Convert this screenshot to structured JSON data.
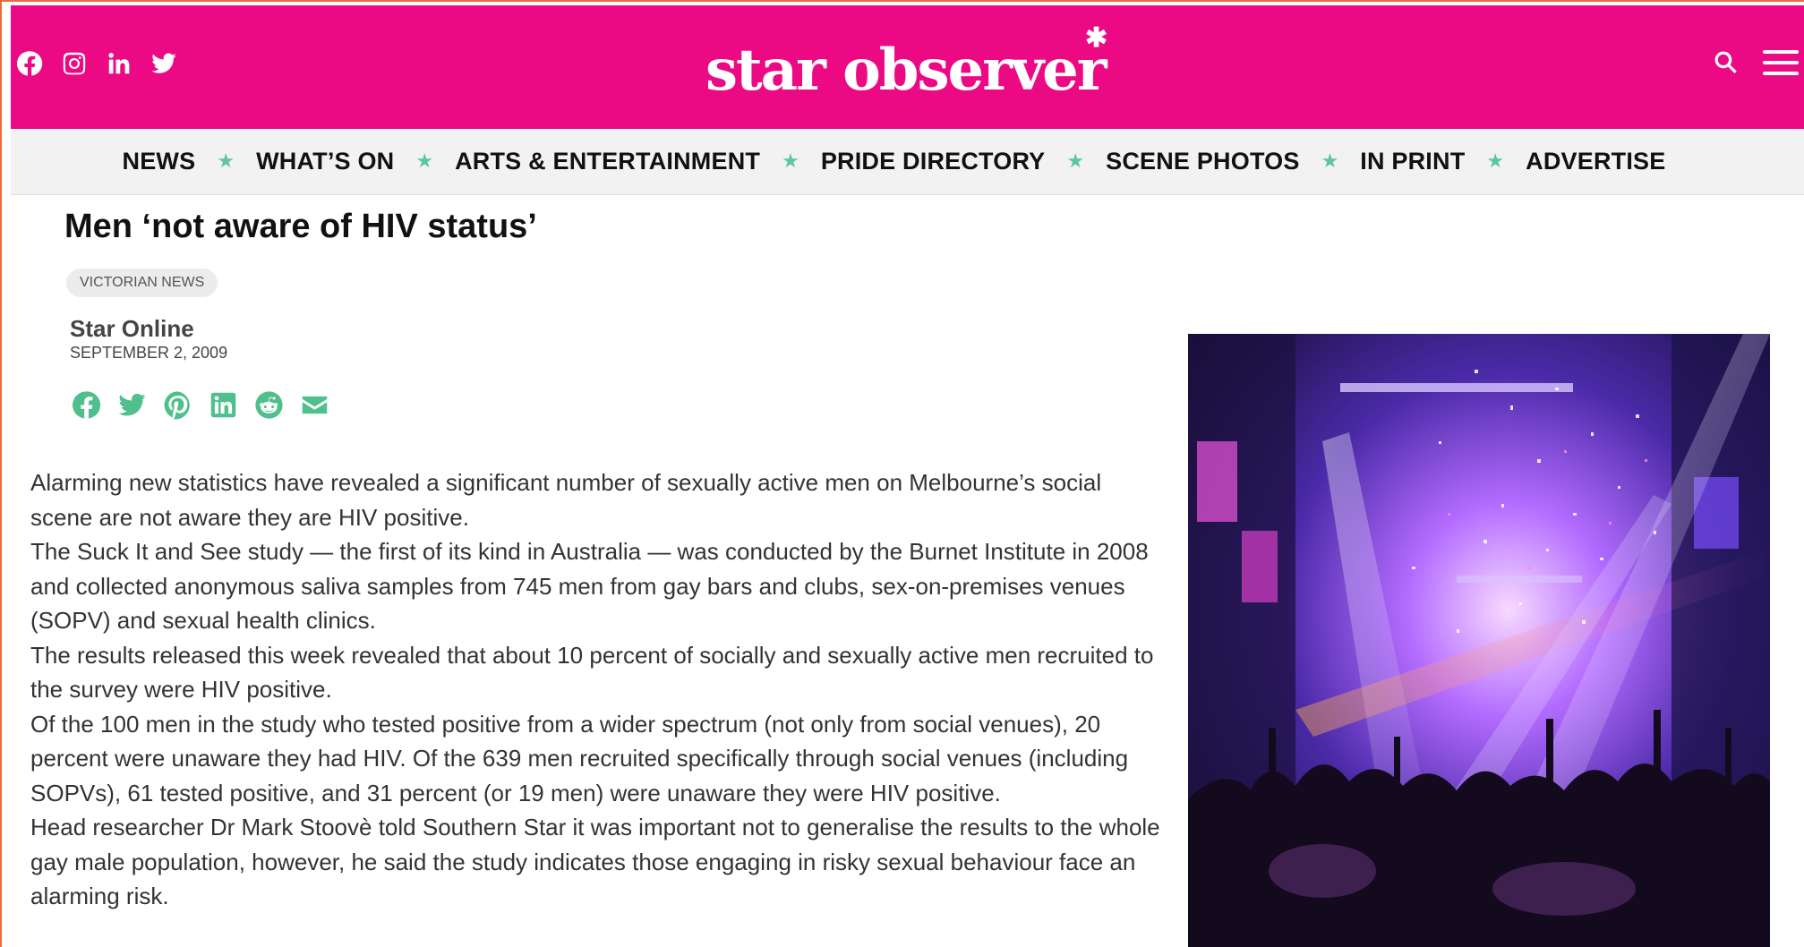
{
  "header": {
    "logo_text": "star observer",
    "social": [
      "facebook-icon",
      "instagram-icon",
      "linkedin-icon",
      "twitter-icon"
    ],
    "brand_color": "#ec0a84"
  },
  "nav": {
    "items": [
      {
        "label": "NEWS"
      },
      {
        "label": "WHAT’S ON"
      },
      {
        "label": "ARTS & ENTERTAINMENT"
      },
      {
        "label": "PRIDE DIRECTORY"
      },
      {
        "label": "SCENE PHOTOS"
      },
      {
        "label": "IN PRINT"
      },
      {
        "label": "ADVERTISE"
      }
    ],
    "separator": "★",
    "accent_color": "#5cc6a0"
  },
  "article": {
    "title": "Men ‘not aware of HIV status’",
    "category": "VICTORIAN NEWS",
    "author": "Star Online",
    "date": "SEPTEMBER 2, 2009",
    "share_icons": [
      "facebook-icon",
      "twitter-icon",
      "pinterest-icon",
      "linkedin-icon",
      "reddit-icon",
      "email-icon"
    ],
    "paragraphs": [
      "Alarming new statistics have revealed a significant number of sexually active men on Melbourne’s social scene are not aware they are HIV positive.",
      "The Suck It and See study — the first of its kind in Australia — was conducted by the Burnet Institute in 2008 and collected anonymous saliva samples from 745 men from gay bars and clubs, sex-on-premises venues (SOPV) and sexual health clinics.",
      "The results released this week revealed that about 10 percent of socially and sexually active men recruited to the survey were HIV positive.",
      "Of the 100 men in the study who tested positive from a wider spectrum (not only from social venues), 20 percent were unaware they had HIV. Of the 639 men recruited specifically through social venues (including SOPVs), 61 tested positive, and 31 percent (or 19 men) were unaware they were HIV positive.",
      "Head researcher Dr Mark Stoovè told Southern Star it was important not to generalise the results to the whole gay male population, however, he said the study indicates those engaging in risky sexual behaviour face an alarming risk."
    ]
  }
}
